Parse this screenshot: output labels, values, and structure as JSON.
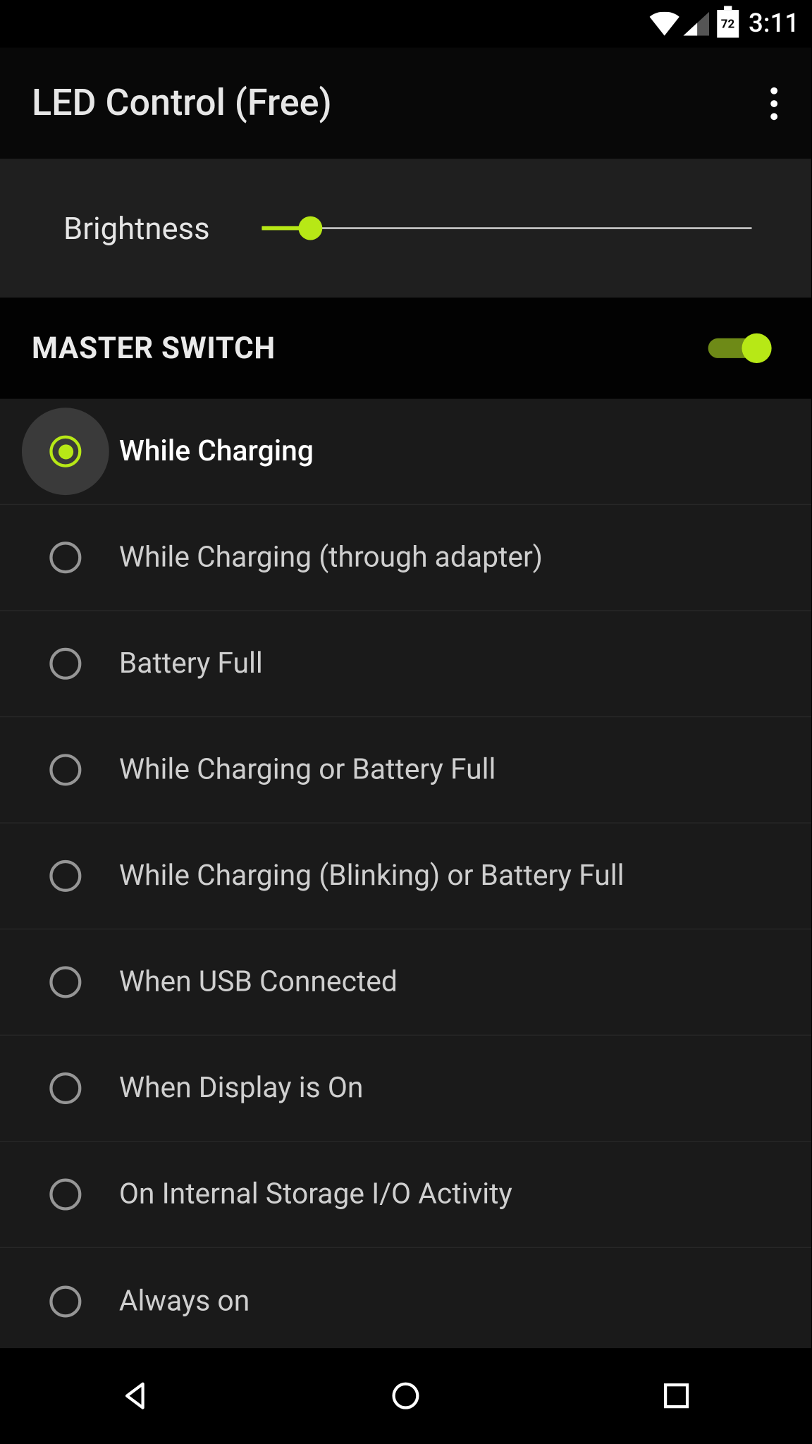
{
  "status_bar": {
    "battery_pct": "72",
    "time": "3:11"
  },
  "app_bar": {
    "title": "LED Control (Free)"
  },
  "brightness": {
    "label": "Brightness",
    "value_pct": 10
  },
  "master_switch": {
    "label": "MASTER SWITCH",
    "on": true
  },
  "options": [
    {
      "label": "While Charging",
      "selected": true
    },
    {
      "label": "While Charging (through adapter)",
      "selected": false
    },
    {
      "label": "Battery Full",
      "selected": false
    },
    {
      "label": "While Charging or Battery Full",
      "selected": false
    },
    {
      "label": "While Charging (Blinking) or Battery Full",
      "selected": false
    },
    {
      "label": "When USB Connected",
      "selected": false
    },
    {
      "label": "When Display is On",
      "selected": false
    },
    {
      "label": "On Internal Storage I/O Activity",
      "selected": false
    },
    {
      "label": "Always on",
      "selected": false
    }
  ]
}
